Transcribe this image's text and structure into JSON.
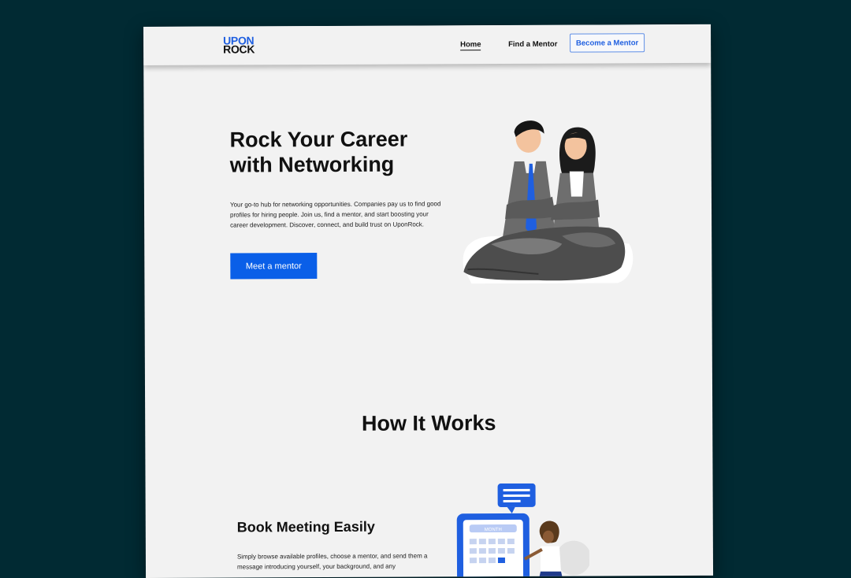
{
  "nav": {
    "logo_line1": "UPON",
    "logo_line2": "ROCK",
    "home": "Home",
    "find_mentor": "Find a Mentor",
    "become_mentor": "Become a Mentor"
  },
  "hero": {
    "title": "Rock Your Career with Networking",
    "description": "Your go-to hub for networking opportunities. Companies pay us to find good profiles for hiring people. Join us, find a mentor, and start boosting your career development. Discover, connect, and build trust on UponRock.",
    "cta": "Meet a mentor"
  },
  "how_it_works": {
    "title": "How It Works",
    "feature_title": "Book Meeting Easily",
    "feature_text": "Simply browse available profiles, choose a mentor, and send them a message introducing yourself, your background, and any",
    "calendar_label": "MONTH"
  },
  "colors": {
    "background": "#012a33",
    "page": "#f2f2f2",
    "accent": "#0a5fe8"
  }
}
